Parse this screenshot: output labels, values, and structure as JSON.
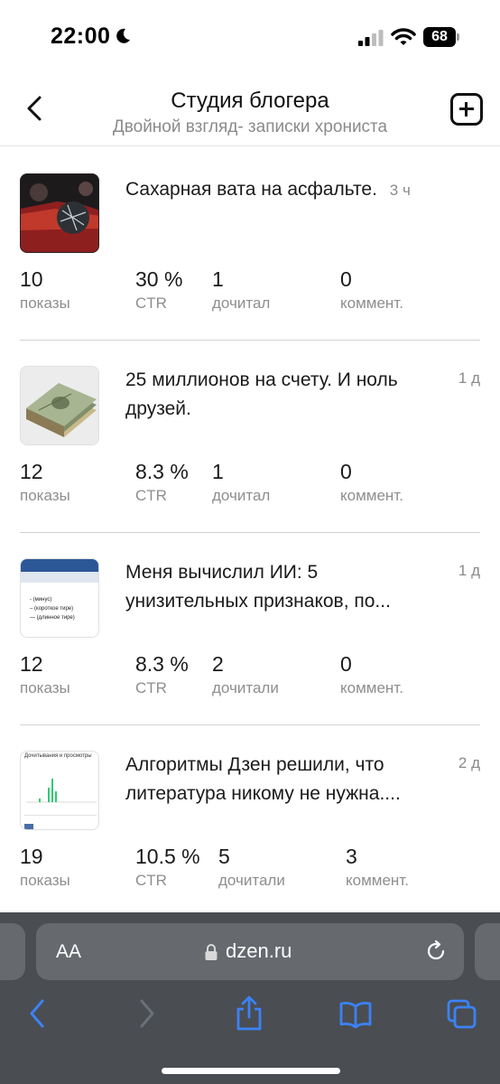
{
  "status": {
    "time": "22:00",
    "battery": "68"
  },
  "header": {
    "title": "Студия блогера",
    "subtitle": "Двойной взгляд- записки хрониста"
  },
  "articles": [
    {
      "title": "Сахарная вата на асфальте.",
      "time": "3 ч",
      "thumbnail": "car-crash-image",
      "shows": "10",
      "shows_label": "показы",
      "ctr": "30 %",
      "ctr_label": "CTR",
      "read": "1",
      "read_label": "дочитал",
      "comments": "0",
      "comments_label": "коммент."
    },
    {
      "title": "25 миллионов на счету. И ноль друзей.",
      "time": "1 д",
      "thumbnail": "money-stack-image",
      "shows": "12",
      "shows_label": "показы",
      "ctr": "8.3 %",
      "ctr_label": "CTR",
      "read": "1",
      "read_label": "дочитал",
      "comments": "0",
      "comments_label": "коммент."
    },
    {
      "title": "Меня вычислил ИИ: 5 унизительных признаков, по...",
      "time": "1 д",
      "thumbnail": "word-document-image",
      "thumb_lines": [
        "- (минус)",
        "– (короткое тире)",
        "— (длинное тире)"
      ],
      "shows": "12",
      "shows_label": "показы",
      "ctr": "8.3 %",
      "ctr_label": "CTR",
      "read": "2",
      "read_label": "дочитали",
      "comments": "0",
      "comments_label": "коммент."
    },
    {
      "title": "Алгоритмы Дзен решили, что литература никому не нужна....",
      "time": "2 д",
      "thumbnail": "stats-chart-image",
      "thumb_title": "Дочитывания и просмотры",
      "shows": "19",
      "shows_label": "показы",
      "ctr": "10.5 %",
      "ctr_label": "CTR",
      "read": "5",
      "read_label": "дочитали",
      "comments": "3",
      "comments_label": "коммент."
    }
  ],
  "browser": {
    "text_size": "AA",
    "url": "dzen.ru"
  },
  "colors": {
    "accent": "#3b82f6",
    "browser_bg": "#4a4d52",
    "url_bar": "#66696e"
  }
}
